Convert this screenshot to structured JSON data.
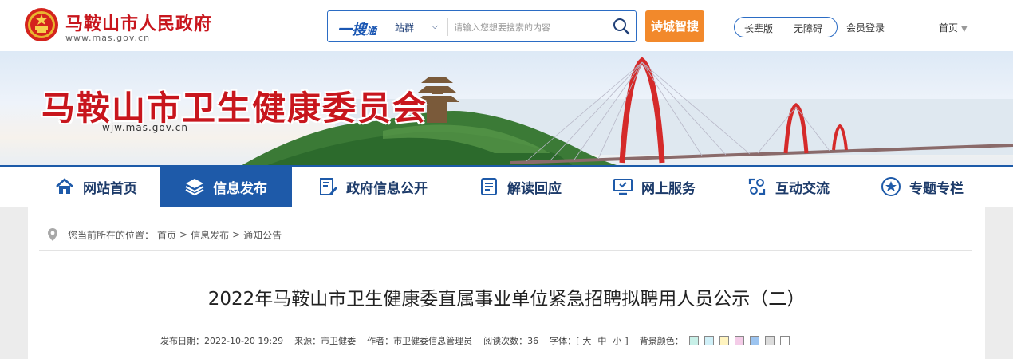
{
  "header": {
    "site_name": "马鞍山市人民政府",
    "site_url": "www.mas.gov.cn",
    "search": {
      "brand": "一搜",
      "brand_suffix": "通",
      "scope": "站群",
      "placeholder": "请输入您想要搜索的内容",
      "value": ""
    },
    "smart_button": "诗城智搜",
    "accessibility": {
      "elder_mode": "长辈版",
      "barrier_free": "无障碍"
    },
    "login": "会员登录",
    "home": "首页"
  },
  "banner": {
    "title": "马鞍山市卫生健康委员会",
    "url": "wjw.mas.gov.cn"
  },
  "nav": {
    "items": [
      {
        "label": "网站首页",
        "icon": "home-icon",
        "active": false
      },
      {
        "label": "信息发布",
        "icon": "layers-icon",
        "active": true
      },
      {
        "label": "政府信息公开",
        "icon": "document-edit-icon",
        "active": false
      },
      {
        "label": "解读回应",
        "icon": "reading-icon",
        "active": false
      },
      {
        "label": "网上服务",
        "icon": "monitor-icon",
        "active": false
      },
      {
        "label": "互动交流",
        "icon": "interaction-icon",
        "active": false
      },
      {
        "label": "专题专栏",
        "icon": "star-icon",
        "active": false
      }
    ]
  },
  "breadcrumb": {
    "prefix": "您当前所在的位置：",
    "items": [
      "首页",
      "信息发布",
      "通知公告"
    ],
    "separator": ">"
  },
  "article": {
    "title": "2022年马鞍山市卫生健康委直属事业单位紧急招聘拟聘用人员公示（二）",
    "meta": {
      "date_label": "发布日期：",
      "date": "2022-10-20 19:29",
      "source_label": "来源：",
      "source": "市卫健委",
      "author_label": "作者：",
      "author": "市卫健委信息管理员",
      "views_label": "阅读次数：",
      "views": "36",
      "font_label": "字体：",
      "font_open": "[",
      "font_sizes": [
        "大",
        "中",
        "小"
      ],
      "font_close": "]",
      "bg_label": "背景颜色："
    },
    "bg_colors": [
      "#c8f0e8",
      "#d0f0f8",
      "#fff4c0",
      "#f4cce8",
      "#9cc4f0",
      "#dcdcdc",
      "#ffffff"
    ]
  },
  "colors": {
    "brand_red": "#c8161d",
    "nav_blue": "#1e5aa9",
    "search_orange": "#f2892b"
  }
}
